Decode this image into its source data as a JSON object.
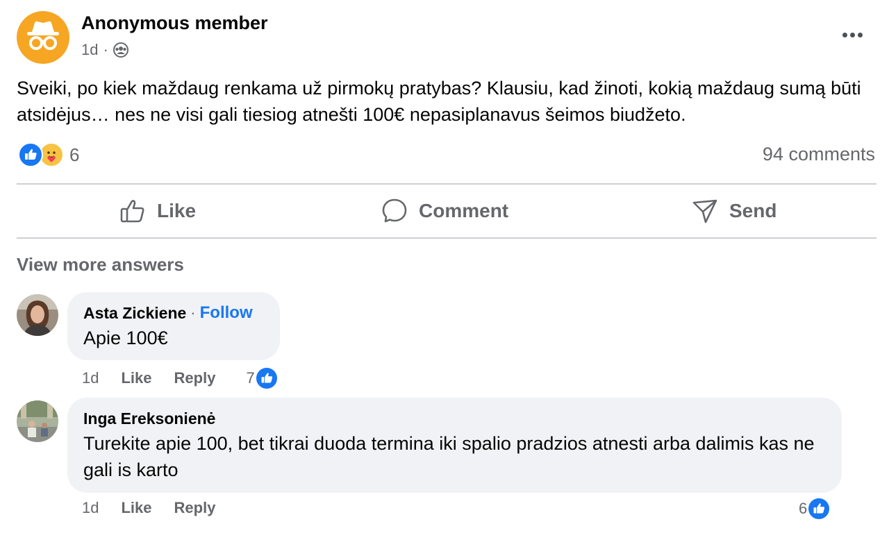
{
  "post": {
    "author": "Anonymous member",
    "time": "1d",
    "separator": "·",
    "audience_icon": "group-icon",
    "text": "Sveiki, po kiek maždaug renkama už pirmokų pratybas? Klausiu, kad žinoti, kokią maždaug sumą būti atsidėjus… nes ne visi gali tiesiog atnešti 100€ nepasiplanavus šeimos biudžeto.",
    "reactions": {
      "icons": [
        "like-icon",
        "care-icon"
      ],
      "count": "6"
    },
    "comments_count": "94 comments"
  },
  "actions": {
    "like": "Like",
    "comment": "Comment",
    "send": "Send"
  },
  "view_more": "View more answers",
  "comments": [
    {
      "author": "Asta Zickiene",
      "separator": "·",
      "follow": "Follow",
      "text": "Apie 100€",
      "time": "1d",
      "like": "Like",
      "reply": "Reply",
      "likes": "7"
    },
    {
      "author": "Inga Ereksonienė",
      "text": "Turekite apie 100, bet tikrai duoda termina iki spalio pradzios atnesti arba dalimis kas ne gali is karto",
      "time": "1d",
      "like": "Like",
      "reply": "Reply",
      "likes": "6"
    }
  ],
  "colors": {
    "accent": "#1877f2",
    "secondary_text": "#65676b",
    "bubble": "#f0f2f5",
    "anon_avatar": "#f6a623"
  }
}
